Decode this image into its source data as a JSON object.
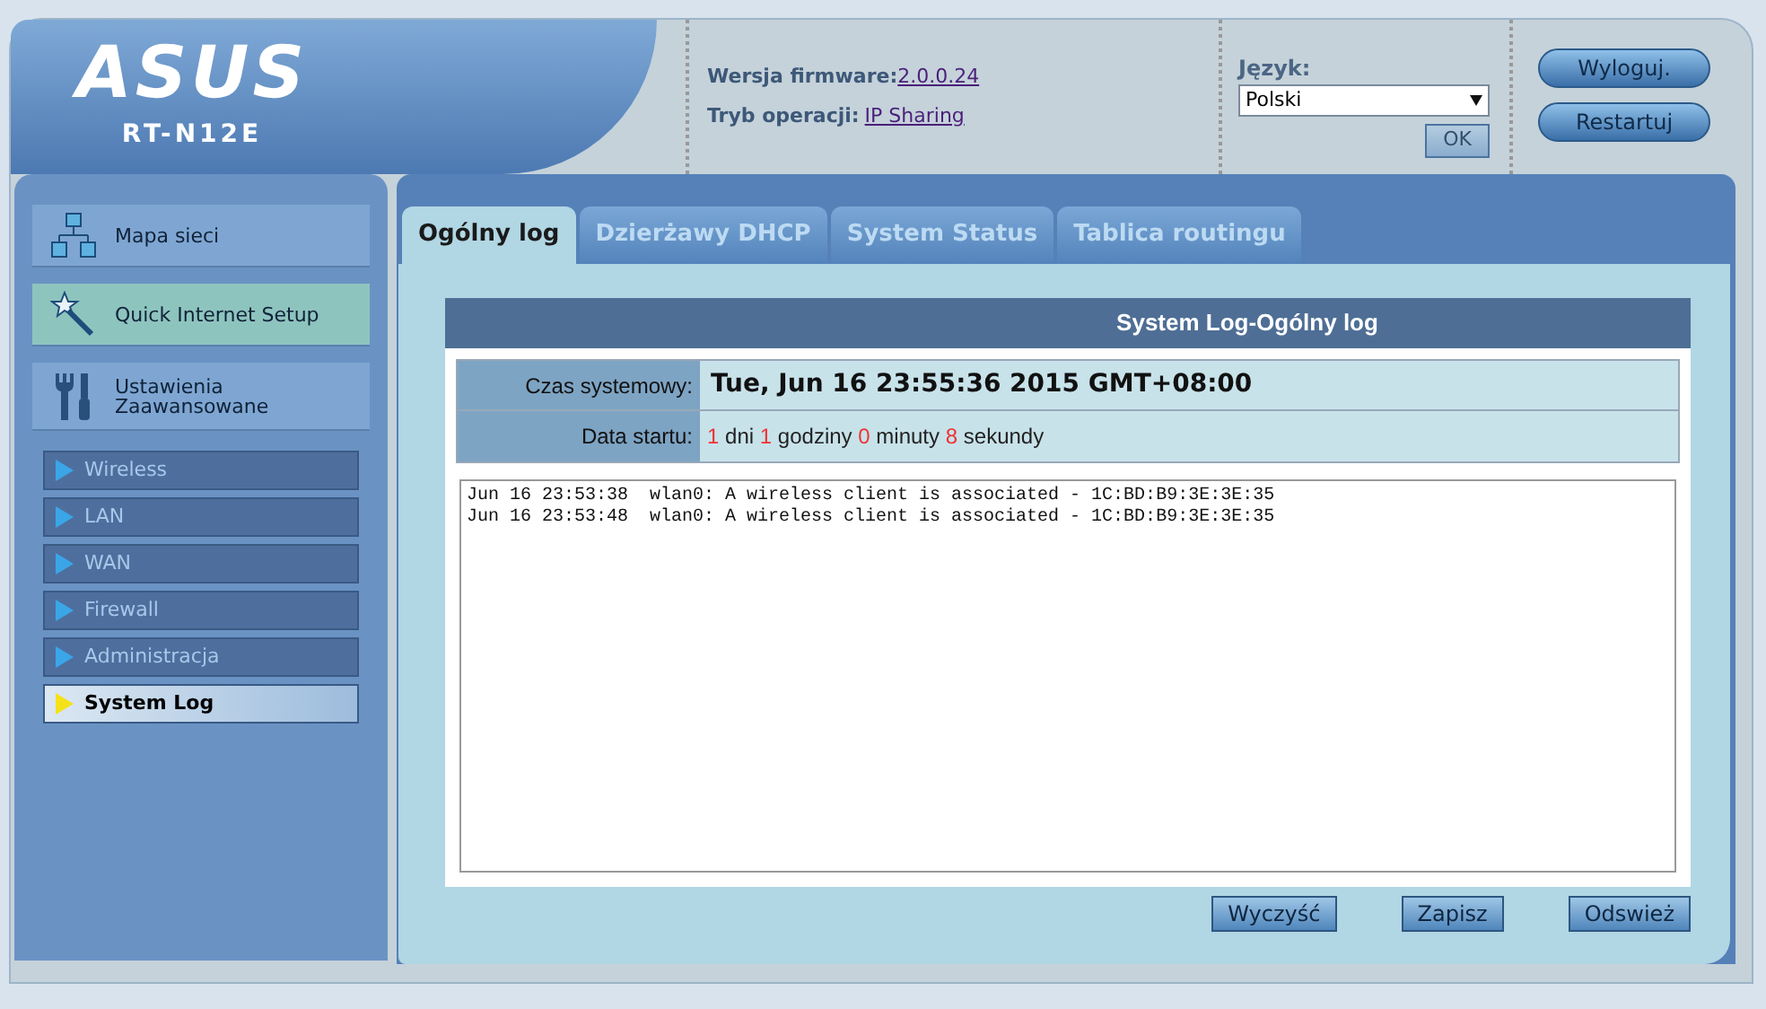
{
  "header": {
    "logo": "ASUS",
    "model": "RT-N12E",
    "firmware_label": "Wersja firmware:",
    "firmware_value": "2.0.0.24",
    "mode_label": "Tryb operacji:",
    "mode_value": "IP Sharing",
    "language_label": "Język:",
    "language_value": "Polski",
    "ok_button": {
      "label": "OK",
      "disabled": true
    },
    "buttons": [
      "Wyloguj.",
      "Restartuj"
    ]
  },
  "sidebar": {
    "main_items": [
      {
        "kind": "network",
        "label": "Mapa sieci",
        "selected": false
      },
      {
        "kind": "wand",
        "label": "Quick Internet Setup",
        "selected": true
      },
      {
        "kind": "tools",
        "label": "Ustawienia Zaawansowane",
        "selected": false
      }
    ],
    "sub_items": [
      {
        "label": "Wireless",
        "selected": false
      },
      {
        "label": "LAN",
        "selected": false
      },
      {
        "label": "WAN",
        "selected": false
      },
      {
        "label": "Firewall",
        "selected": false
      },
      {
        "label": "Administracja",
        "selected": false
      },
      {
        "label": "System Log",
        "selected": true
      }
    ]
  },
  "tabs": [
    {
      "label": "Ogólny log",
      "selected": true
    },
    {
      "label": "Dzierżawy DHCP",
      "selected": false
    },
    {
      "label": "System Status",
      "selected": false
    },
    {
      "label": "Tablica routingu",
      "selected": false
    }
  ],
  "panel": {
    "title": "System Log-Ogólny log",
    "system_time_label": "Czas systemowy:",
    "system_time": "Tue, Jun 16 23:55:36 2015 GMT+08:00",
    "uptime_label": "Data startu:",
    "uptime": [
      {
        "value": "1",
        "unit": "dni"
      },
      {
        "value": "1",
        "unit": "godziny"
      },
      {
        "value": "0",
        "unit": "minuty"
      },
      {
        "value": "8",
        "unit": "sekundy"
      }
    ],
    "log_lines": [
      "Jun 16 23:53:38  wlan0: A wireless client is associated - 1C:BD:B9:3E:3E:35",
      "Jun 16 23:53:48  wlan0: A wireless client is associated - 1C:BD:B9:3E:3E:35"
    ],
    "buttons": [
      "Wyczyść",
      "Zapisz",
      "Odswież"
    ]
  }
}
